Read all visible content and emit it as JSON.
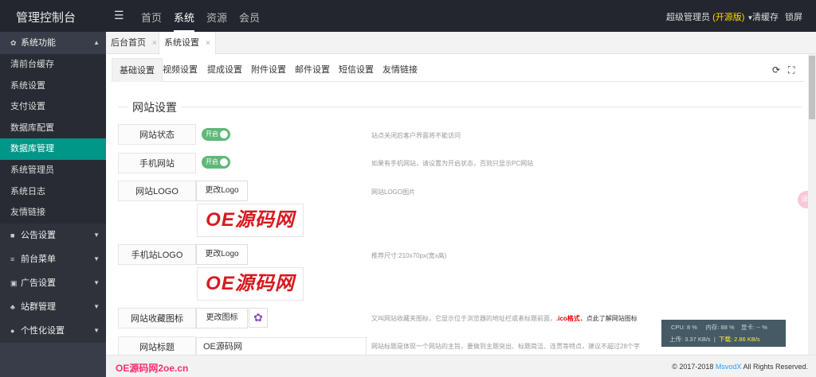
{
  "header": {
    "title": "管理控制台",
    "menu_icon": "list-icon",
    "nav": [
      "首页",
      "系统",
      "资源",
      "会员"
    ],
    "active_nav": "系统",
    "user": "超级管理员",
    "edition": "(开源版)",
    "clear_cache": "清缓存",
    "lock": "锁屏"
  },
  "sidebar": {
    "open_group": "系统功能",
    "items": [
      "清前台缓存",
      "系统设置",
      "支付设置",
      "数据库配置",
      "数据库管理",
      "系统管理员",
      "系统日志",
      "友情链接"
    ],
    "selected": "数据库管理",
    "groups": [
      "公告设置",
      "前台菜单",
      "广告设置",
      "站群管理",
      "个性化设置"
    ]
  },
  "page_tabs": [
    {
      "label": "后台首页",
      "close": "×"
    },
    {
      "label": "系统设置",
      "close": "×"
    }
  ],
  "sub_tabs": [
    "基础设置",
    "视频设置",
    "提成设置",
    "附件设置",
    "邮件设置",
    "短信设置",
    "友情链接"
  ],
  "active_sub_tab": "基础设置",
  "fieldset_title": "网站设置",
  "form": {
    "status_label": "网站状态",
    "status_switch": "开启",
    "status_hint": "站点关闭后客户界面将不能访问",
    "mobile_label": "手机网站",
    "mobile_switch": "开启",
    "mobile_hint": "如果有手机网站，请设置为开启状态，否则只显示PC网站",
    "logo_label": "网站LOGO",
    "logo_button": "更改Logo",
    "logo_hint": "网站LOGO图片",
    "logo_text": "OE源码网",
    "mlogo_label": "手机站LOGO",
    "mlogo_button": "更改Logo",
    "mlogo_hint": "推荐尺寸:210x70px(宽x高)",
    "mlogo_text": "OE源码网",
    "fav_label": "网站收藏图标",
    "fav_button": "更改图标",
    "fav_hint_a": "又叫网站收藏夹图标，它显示位于浏览器的地址栏或者标题前面，",
    "fav_hint_b": ".ico格式",
    "fav_hint_c": "，点此了解网站图标",
    "title_label": "网站标题",
    "title_value": "OE源码网",
    "title_hint": "网站标题是体现一个网站的主旨，要做到主题突出、标题简洁、连贯等特点，建议不超过28个字"
  },
  "footer": {
    "left": "OE源码网2oe.cn",
    "copyright": "© 2017-2018",
    "brand": "MsvodX",
    "rights": "All Rights Reserved."
  },
  "monitor": {
    "cpu": "CPU: 8 %",
    "mem": "内存: 88 %",
    "gpu": "显卡: -- %",
    "up": "上传: 3.37 KB/s",
    "down": "下载: 2.86 KB/s"
  },
  "translate_badge": "译文",
  "colors": {
    "header": "#23262e",
    "sidebar": "#393d49",
    "selected": "#009688",
    "switch_on": "#5fb878",
    "edition": "#ffdd00"
  }
}
